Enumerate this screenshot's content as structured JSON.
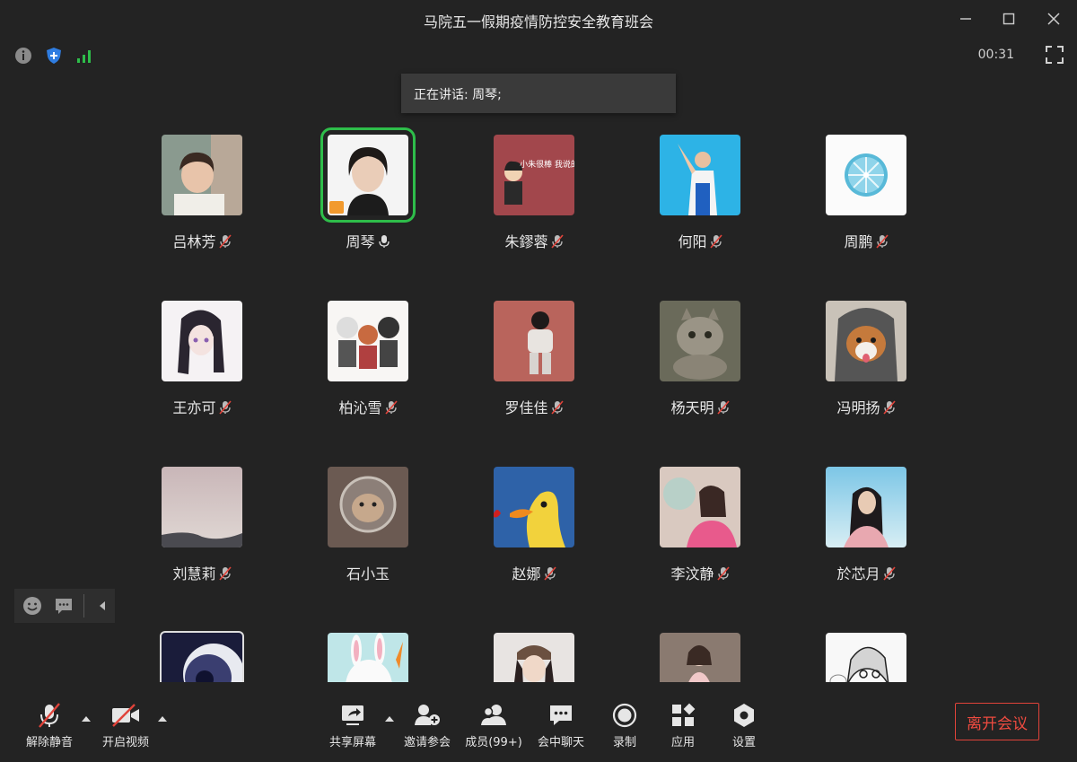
{
  "window": {
    "title": "马院五一假期疫情防控安全教育班会"
  },
  "status": {
    "timer": "00:31",
    "info_icon": "info-icon",
    "shield_icon": "shield-icon",
    "signal_icon": "signal-icon"
  },
  "speaker": {
    "text": "正在讲话: 周琴;"
  },
  "participants": [
    {
      "name": "吕林芳",
      "muted": true
    },
    {
      "name": "周琴",
      "muted": false,
      "active": true
    },
    {
      "name": "朱鏐蓉",
      "muted": true
    },
    {
      "name": "何阳",
      "muted": true
    },
    {
      "name": "周鹏",
      "muted": true
    },
    {
      "name": "王亦可",
      "muted": true
    },
    {
      "name": "柏沁雪",
      "muted": true
    },
    {
      "name": "罗佳佳",
      "muted": true
    },
    {
      "name": "杨天明",
      "muted": true
    },
    {
      "name": "冯明扬",
      "muted": true
    },
    {
      "name": "刘慧莉",
      "muted": true
    },
    {
      "name": "石小玉",
      "muted": null
    },
    {
      "name": "赵娜",
      "muted": true
    },
    {
      "name": "李汶静",
      "muted": true
    },
    {
      "name": "於芯月",
      "muted": true
    },
    {
      "name": "",
      "muted": null
    },
    {
      "name": "",
      "muted": null
    },
    {
      "name": "",
      "muted": null
    },
    {
      "name": "",
      "muted": null
    },
    {
      "name": "",
      "muted": null
    }
  ],
  "avatar_text": {
    "zhu": "小朱很棒 我说的"
  },
  "toolbar": {
    "unmute": "解除静音",
    "start_video": "开启视频",
    "share_screen": "共享屏幕",
    "invite": "邀请参会",
    "members": "成员(99+)",
    "chat": "会中聊天",
    "record": "录制",
    "apps": "应用",
    "settings": "设置",
    "leave": "离开会议"
  },
  "colors": {
    "accent_green": "#2ebd4a",
    "leave_red": "#ef4b40",
    "shield_blue": "#2f7de1"
  }
}
